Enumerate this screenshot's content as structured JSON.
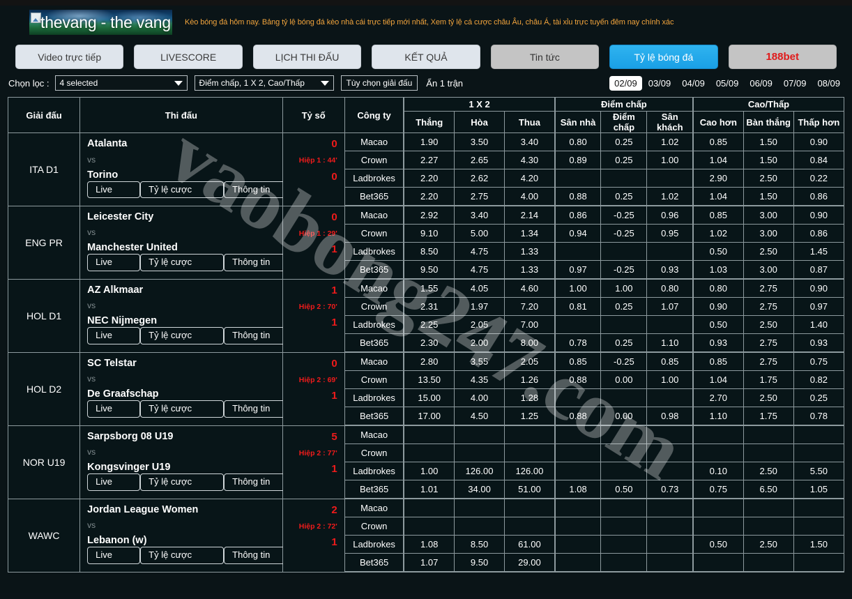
{
  "site": {
    "logo_text": "thevang - the vang tv",
    "tagline": "Kèo bóng đá hôm nay. Bảng tỷ lệ bóng đá kèo nhà cái trực tiếp mới nhất, Xem tỷ lệ cá cược châu Âu, châu Á, tài xỉu trực tuyến đêm nay chính xác",
    "watermark": "vaobong247.com",
    "accent_blue": "#1aa0e6",
    "accent_red": "#ef1b1b",
    "accent_orange": "#f0a33c"
  },
  "nav": {
    "items": [
      {
        "label": "Video trực tiếp",
        "style": "light"
      },
      {
        "label": "LIVESCORE",
        "style": "light"
      },
      {
        "label": "LỊCH THI ĐẤU",
        "style": "light"
      },
      {
        "label": "KẾT QUẢ",
        "style": "light"
      },
      {
        "label": "Tin tức",
        "style": "grey"
      },
      {
        "label": "Tỷ lệ bóng đá",
        "style": "active"
      },
      {
        "label": "188bet",
        "style": "bet"
      }
    ]
  },
  "filters": {
    "label": "Chọn lọc :",
    "select_leagues": "4 selected",
    "select_markets": "Điểm chấp, 1 X 2, Cao/Thấp",
    "league_options_button": "Tùy chọn giải đấu",
    "hide_text": "Ẩn 1 trận",
    "dates": [
      "02/09",
      "03/09",
      "04/09",
      "05/09",
      "06/09",
      "07/09",
      "08/09"
    ],
    "selected_date": "02/09"
  },
  "table": {
    "headers": {
      "league": "Giải đấu",
      "match": "Thi đấu",
      "score": "Tỷ số",
      "company": "Công ty",
      "group_1x2": "1 X 2",
      "group_handicap": "Điểm chấp",
      "group_ou": "Cao/Thấp",
      "win": "Thắng",
      "draw": "Hòa",
      "lose": "Thua",
      "home": "Sân nhà",
      "handicap": "Điểm chấp",
      "away": "Sân khách",
      "over": "Cao hơn",
      "goals": "Bàn thắng",
      "under": "Thấp hơn"
    },
    "buttons": {
      "live": "Live",
      "odds": "Tỷ lệ cược",
      "info": "Thông tin"
    },
    "rows": [
      {
        "league": "ITA D1",
        "home_team": "Atalanta",
        "away_team": "Torino",
        "vs": "vs",
        "home_score": "0",
        "away_score": "0",
        "minute": "Hiệp 1 : 44'",
        "books": [
          {
            "name": "Macao",
            "win": "1.90",
            "draw": "3.50",
            "lose": "3.40",
            "home": "0.80",
            "hcp": "0.25",
            "away": "1.02",
            "over": "0.85",
            "goals": "1.50",
            "under": "0.90"
          },
          {
            "name": "Crown",
            "win": "2.27",
            "draw": "2.65",
            "lose": "4.30",
            "home": "0.89",
            "hcp": "0.25",
            "away": "1.00",
            "over": "1.04",
            "goals": "1.50",
            "under": "0.84"
          },
          {
            "name": "Ladbrokes",
            "win": "2.20",
            "draw": "2.62",
            "lose": "4.20",
            "home": "",
            "hcp": "",
            "away": "",
            "over": "2.90",
            "goals": "2.50",
            "under": "0.22"
          },
          {
            "name": "Bet365",
            "win": "2.20",
            "draw": "2.75",
            "lose": "4.00",
            "home": "0.88",
            "hcp": "0.25",
            "away": "1.02",
            "over": "1.04",
            "goals": "1.50",
            "under": "0.86"
          }
        ]
      },
      {
        "league": "ENG PR",
        "home_team": "Leicester City",
        "away_team": "Manchester United",
        "vs": "vs",
        "home_score": "0",
        "away_score": "1",
        "minute": "Hiệp 1 : 29'",
        "books": [
          {
            "name": "Macao",
            "win": "2.92",
            "draw": "3.40",
            "lose": "2.14",
            "home": "0.86",
            "hcp": "-0.25",
            "away": "0.96",
            "over": "0.85",
            "goals": "3.00",
            "under": "0.90"
          },
          {
            "name": "Crown",
            "win": "9.10",
            "draw": "5.00",
            "lose": "1.34",
            "home": "0.94",
            "hcp": "-0.25",
            "away": "0.95",
            "over": "1.02",
            "goals": "3.00",
            "under": "0.86"
          },
          {
            "name": "Ladbrokes",
            "win": "8.50",
            "draw": "4.75",
            "lose": "1.33",
            "home": "",
            "hcp": "",
            "away": "",
            "over": "0.50",
            "goals": "2.50",
            "under": "1.45"
          },
          {
            "name": "Bet365",
            "win": "9.50",
            "draw": "4.75",
            "lose": "1.33",
            "home": "0.97",
            "hcp": "-0.25",
            "away": "0.93",
            "over": "1.03",
            "goals": "3.00",
            "under": "0.87"
          }
        ]
      },
      {
        "league": "HOL D1",
        "home_team": "AZ Alkmaar",
        "away_team": "NEC Nijmegen",
        "vs": "vs",
        "home_score": "1",
        "away_score": "1",
        "minute": "Hiệp 2 : 70'",
        "books": [
          {
            "name": "Macao",
            "win": "1.55",
            "draw": "4.05",
            "lose": "4.60",
            "home": "1.00",
            "hcp": "1.00",
            "away": "0.80",
            "over": "0.80",
            "goals": "2.75",
            "under": "0.90"
          },
          {
            "name": "Crown",
            "win": "2.31",
            "draw": "1.97",
            "lose": "7.20",
            "home": "0.81",
            "hcp": "0.25",
            "away": "1.07",
            "over": "0.90",
            "goals": "2.75",
            "under": "0.97"
          },
          {
            "name": "Ladbrokes",
            "win": "2.25",
            "draw": "2.05",
            "lose": "7.00",
            "home": "",
            "hcp": "",
            "away": "",
            "over": "0.50",
            "goals": "2.50",
            "under": "1.40"
          },
          {
            "name": "Bet365",
            "win": "2.30",
            "draw": "2.00",
            "lose": "8.00",
            "home": "0.78",
            "hcp": "0.25",
            "away": "1.10",
            "over": "0.93",
            "goals": "2.75",
            "under": "0.93"
          }
        ]
      },
      {
        "league": "HOL D2",
        "home_team": "SC Telstar",
        "away_team": "De Graafschap",
        "vs": "vs",
        "home_score": "0",
        "away_score": "1",
        "minute": "Hiệp 2 : 69'",
        "books": [
          {
            "name": "Macao",
            "win": "2.80",
            "draw": "3.55",
            "lose": "2.05",
            "home": "0.85",
            "hcp": "-0.25",
            "away": "0.85",
            "over": "0.85",
            "goals": "2.75",
            "under": "0.75"
          },
          {
            "name": "Crown",
            "win": "13.50",
            "draw": "4.35",
            "lose": "1.26",
            "home": "0.88",
            "hcp": "0.00",
            "away": "1.00",
            "over": "1.04",
            "goals": "1.75",
            "under": "0.82"
          },
          {
            "name": "Ladbrokes",
            "win": "15.00",
            "draw": "4.00",
            "lose": "1.28",
            "home": "",
            "hcp": "",
            "away": "",
            "over": "2.70",
            "goals": "2.50",
            "under": "0.25"
          },
          {
            "name": "Bet365",
            "win": "17.00",
            "draw": "4.50",
            "lose": "1.25",
            "home": "0.88",
            "hcp": "0.00",
            "away": "0.98",
            "over": "1.10",
            "goals": "1.75",
            "under": "0.78"
          }
        ]
      },
      {
        "league": "NOR U19",
        "home_team": "Sarpsborg 08 U19",
        "away_team": "Kongsvinger U19",
        "vs": "vs",
        "home_score": "5",
        "away_score": "1",
        "minute": "Hiệp 2 : 77'",
        "books": [
          {
            "name": "Macao",
            "win": "",
            "draw": "",
            "lose": "",
            "home": "",
            "hcp": "",
            "away": "",
            "over": "",
            "goals": "",
            "under": ""
          },
          {
            "name": "Crown",
            "win": "",
            "draw": "",
            "lose": "",
            "home": "",
            "hcp": "",
            "away": "",
            "over": "",
            "goals": "",
            "under": ""
          },
          {
            "name": "Ladbrokes",
            "win": "1.00",
            "draw": "126.00",
            "lose": "126.00",
            "home": "",
            "hcp": "",
            "away": "",
            "over": "0.10",
            "goals": "2.50",
            "under": "5.50"
          },
          {
            "name": "Bet365",
            "win": "1.01",
            "draw": "34.00",
            "lose": "51.00",
            "home": "1.08",
            "hcp": "0.50",
            "away": "0.73",
            "over": "0.75",
            "goals": "6.50",
            "under": "1.05"
          }
        ]
      },
      {
        "league": "WAWC",
        "home_team": "Jordan League Women",
        "away_team": "Lebanon (w)",
        "vs": "vs",
        "home_score": "2",
        "away_score": "1",
        "minute": "Hiệp 2 : 72'",
        "books": [
          {
            "name": "Macao",
            "win": "",
            "draw": "",
            "lose": "",
            "home": "",
            "hcp": "",
            "away": "",
            "over": "",
            "goals": "",
            "under": ""
          },
          {
            "name": "Crown",
            "win": "",
            "draw": "",
            "lose": "",
            "home": "",
            "hcp": "",
            "away": "",
            "over": "",
            "goals": "",
            "under": ""
          },
          {
            "name": "Ladbrokes",
            "win": "1.08",
            "draw": "8.50",
            "lose": "61.00",
            "home": "",
            "hcp": "",
            "away": "",
            "over": "0.50",
            "goals": "2.50",
            "under": "1.50"
          },
          {
            "name": "Bet365",
            "win": "1.07",
            "draw": "9.50",
            "lose": "29.00",
            "home": "",
            "hcp": "",
            "away": "",
            "over": "",
            "goals": "",
            "under": ""
          }
        ]
      }
    ]
  }
}
